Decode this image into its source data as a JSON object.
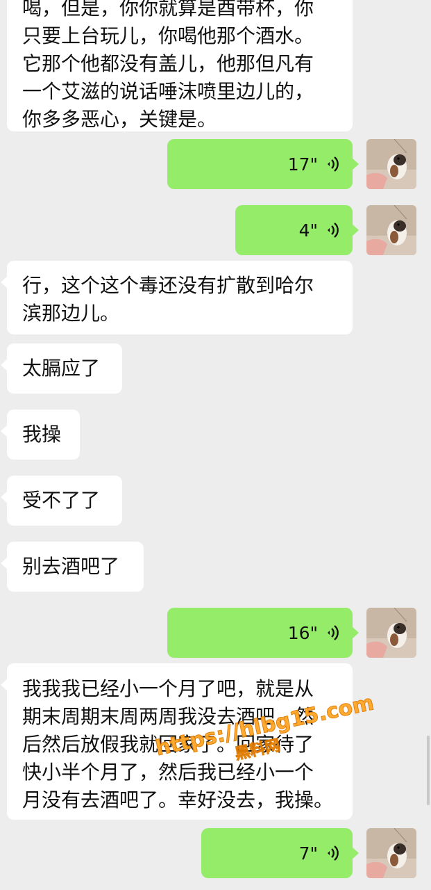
{
  "colors": {
    "background": "#ededed",
    "incoming_bubble": "#ffffff",
    "outgoing_bubble": "#95ec69",
    "watermark": "#ffa726"
  },
  "messages": [
    {
      "type": "incoming_text",
      "lines": [
        "喝，但是，你你就算是酉带杯，你",
        "只要上台玩儿，你喝他那个酒水。",
        "它那个他都没有盖儿，他那但凡有",
        "一个艾滋的说话唾沫喷里边儿的，",
        "你多多恶心，关键是。"
      ]
    },
    {
      "type": "outgoing_voice",
      "duration": "17\"",
      "icon": "voice-wave-icon"
    },
    {
      "type": "outgoing_voice",
      "duration": "4\"",
      "icon": "voice-wave-icon"
    },
    {
      "type": "incoming_text",
      "lines": [
        "行，这个这个毒还没有扩散到哈尔",
        "滨那边儿。"
      ]
    },
    {
      "type": "incoming_text",
      "lines": [
        "太膈应了"
      ]
    },
    {
      "type": "incoming_text",
      "lines": [
        "我操"
      ]
    },
    {
      "type": "incoming_text",
      "lines": [
        "受不了了"
      ]
    },
    {
      "type": "incoming_text",
      "lines": [
        "别去酒吧了"
      ]
    },
    {
      "type": "outgoing_voice",
      "duration": "16\"",
      "icon": "voice-wave-icon"
    },
    {
      "type": "incoming_text",
      "lines": [
        "我我我已经小一个月了吧，就是从",
        "期末周期末周两周我没去酒吧，然",
        "后然后放假我就回家了。回家待了",
        "快小半个月了，然后我已经小一个",
        "月没有去酒吧了。幸好没去，我操。"
      ]
    },
    {
      "type": "outgoing_voice",
      "duration": "7\"",
      "icon": "voice-wave-icon"
    }
  ],
  "watermark": {
    "url": "https://hlbg15.com",
    "name": "黑料网"
  },
  "avatar": {
    "icon": "hamster-avatar-icon"
  }
}
